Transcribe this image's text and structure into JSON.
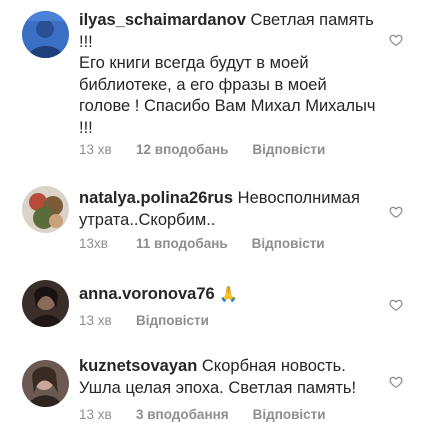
{
  "comments": [
    {
      "username": "ilyas_schaimardanov",
      "text": "Светлая память !!!\nЕго книги всегда будут в моей библиотеке, а его фразы в моей голове ! Спасибо Вам Михал Михалыч !!!",
      "time": "13 хв",
      "likes": "12 вподобань",
      "reply": "Відповісти"
    },
    {
      "username": "natalya.polina26rus",
      "text": "Невосполнимая утрата..Скорбим..",
      "time": "13хв",
      "likes": "11 вподобань",
      "reply": "Відповісти"
    },
    {
      "username": "anna.voronova76",
      "text": "🙏",
      "time": "13 хв",
      "likes": "",
      "reply": "Відповісти"
    },
    {
      "username": "kuznetsovayan",
      "text": "Скорбная новость. Ушла целая эпоха. Светлая память!",
      "time": "13 хв",
      "likes": "3 вподобання",
      "reply": "Відповісти"
    }
  ],
  "colors": {
    "text": "#262626",
    "meta": "#8e8e8e",
    "heart_outline": "#8e8e8e"
  },
  "icons": {
    "like": "heart-outline-icon"
  }
}
